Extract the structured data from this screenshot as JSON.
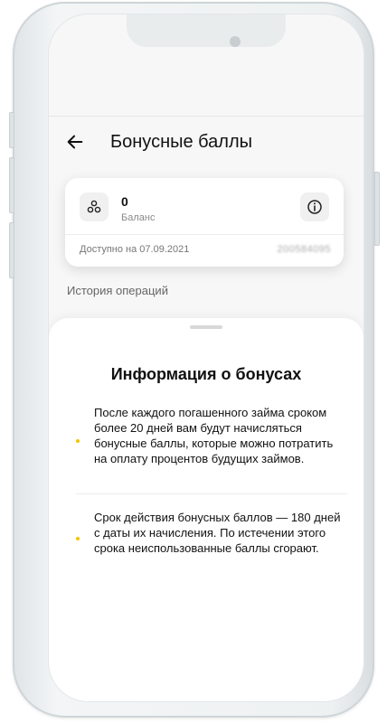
{
  "header": {
    "title": "Бонусные баллы"
  },
  "balance_card": {
    "value": "0",
    "label": "Баланс",
    "available": "Доступно на 07.09.2021",
    "number": "200584095"
  },
  "history": {
    "label": "История операций"
  },
  "sheet": {
    "title": "Информация о бонусах",
    "items": [
      {
        "text": "После каждого погашенного займа сроком более 20 дней вам будут начисляться бонусные баллы, которые можно потратить на оплату процентов будущих займов."
      },
      {
        "text": "Срок действия бонусных баллов — 180 дней с даты их начисления. По истечении этого срока неиспользованные баллы сгорают."
      }
    ]
  },
  "colors": {
    "accent": "#f5c500",
    "text_primary": "#111111",
    "text_secondary": "#777777"
  },
  "icons": {
    "back": "arrow-left-icon",
    "points": "bonus-points-icon",
    "info": "info-icon"
  }
}
